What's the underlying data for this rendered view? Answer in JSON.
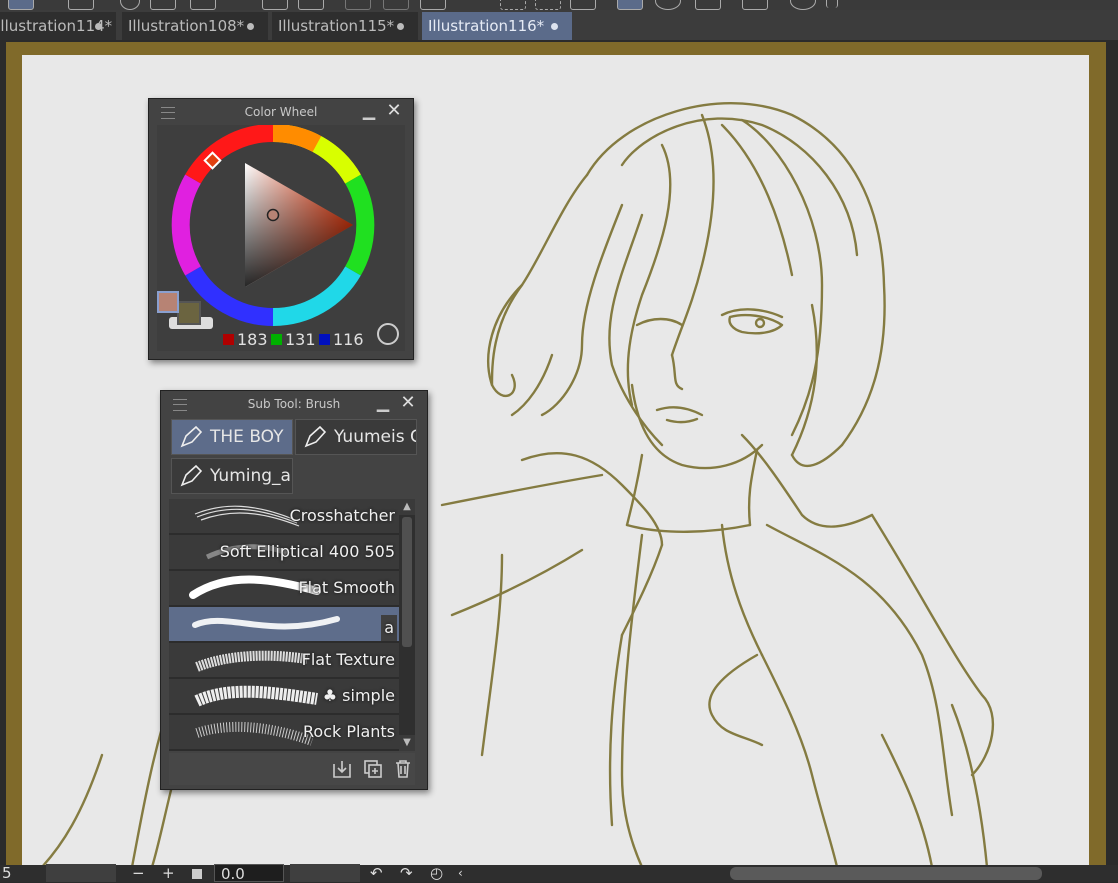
{
  "tabs": [
    {
      "label": "Illustration114*",
      "active": false
    },
    {
      "label": "Illustration108*",
      "active": false
    },
    {
      "label": "Illustration115*",
      "active": false
    },
    {
      "label": "Illustration116*",
      "active": true
    }
  ],
  "color_wheel": {
    "title": "Color Wheel",
    "r": "183",
    "g": "131",
    "b": "116",
    "main_color": "#b78374",
    "sub_color": "#6b6440"
  },
  "brush_panel": {
    "title": "Sub Tool: Brush",
    "groups": [
      "THE BOY",
      "Yuumeis C",
      "Yuming_a"
    ],
    "brushes": [
      {
        "name": "Crosshatcher",
        "active": false
      },
      {
        "name": "Soft Elliptical 400 505",
        "active": false
      },
      {
        "name": "Flat Smooth",
        "active": false
      },
      {
        "name": "a",
        "active": true
      },
      {
        "name": "Flat Texture",
        "active": false
      },
      {
        "name": "♣ simple",
        "active": false
      },
      {
        "name": "Rock Plants",
        "active": false
      }
    ]
  },
  "statusbar": {
    "left_value": "5",
    "rotation_value": "0.0",
    "zoom_out": "−",
    "zoom_in": "+"
  },
  "colors": {
    "paper_border": "#806a2a",
    "sketch_stroke": "#7a7030",
    "accent_selected": "#5b6b8a"
  }
}
